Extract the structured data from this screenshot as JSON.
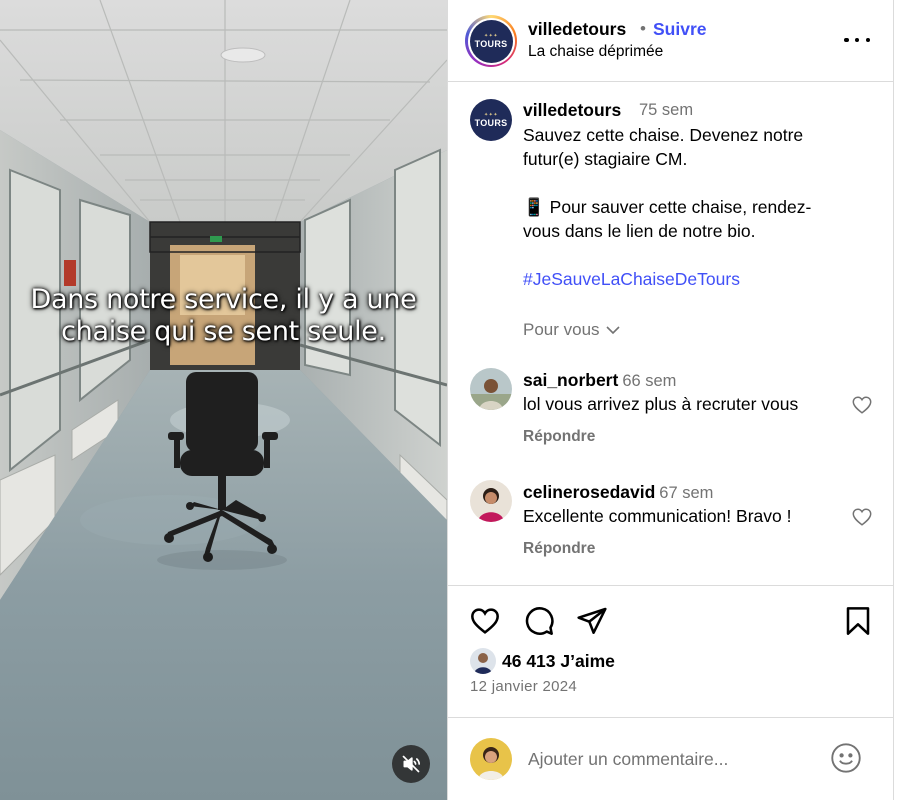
{
  "media": {
    "overlay_line1": "Dans notre service, il y a une",
    "overlay_line2": "chaise qui se sent seule.",
    "mute_icon": "speaker-muted-icon"
  },
  "header": {
    "username": "villedetours",
    "dot": "•",
    "follow_label": "Suivre",
    "subtitle": "La chaise déprimée",
    "logo_crown": "✦✦✦",
    "logo_word": "TOURS"
  },
  "caption": {
    "username": "villedetours",
    "time": "75 sem",
    "line1": "Sauvez cette chaise. Devenez notre",
    "line2": "futur(e) stagiaire CM.",
    "line3": "📱 Pour sauver cette chaise, rendez-",
    "line4": "vous dans le lien de notre bio.",
    "hashtag": "#JeSauveLaChaiseDeTours",
    "pour_vous": "Pour vous"
  },
  "comments": [
    {
      "username": "sai_norbert",
      "time": "66 sem",
      "text": "lol vous arrivez plus à recruter vous",
      "reply": "Répondre"
    },
    {
      "username": "celinerosedavid",
      "time": "67 sem",
      "text": "Excellente communication! Bravo !",
      "reply": "Répondre"
    }
  ],
  "actions": {
    "icons": [
      "heart-icon",
      "comment-icon",
      "share-icon",
      "bookmark-icon"
    ],
    "likes": "46 413 J’aime",
    "date": "12 janvier 2024"
  },
  "composer": {
    "placeholder": "Ajouter un commentaire...",
    "emoji_icon": "smiley-icon"
  },
  "colors": {
    "accent": "#4150f7",
    "muted": "#737373",
    "border": "#dbdbdb",
    "brand_navy": "#1f2b59"
  }
}
